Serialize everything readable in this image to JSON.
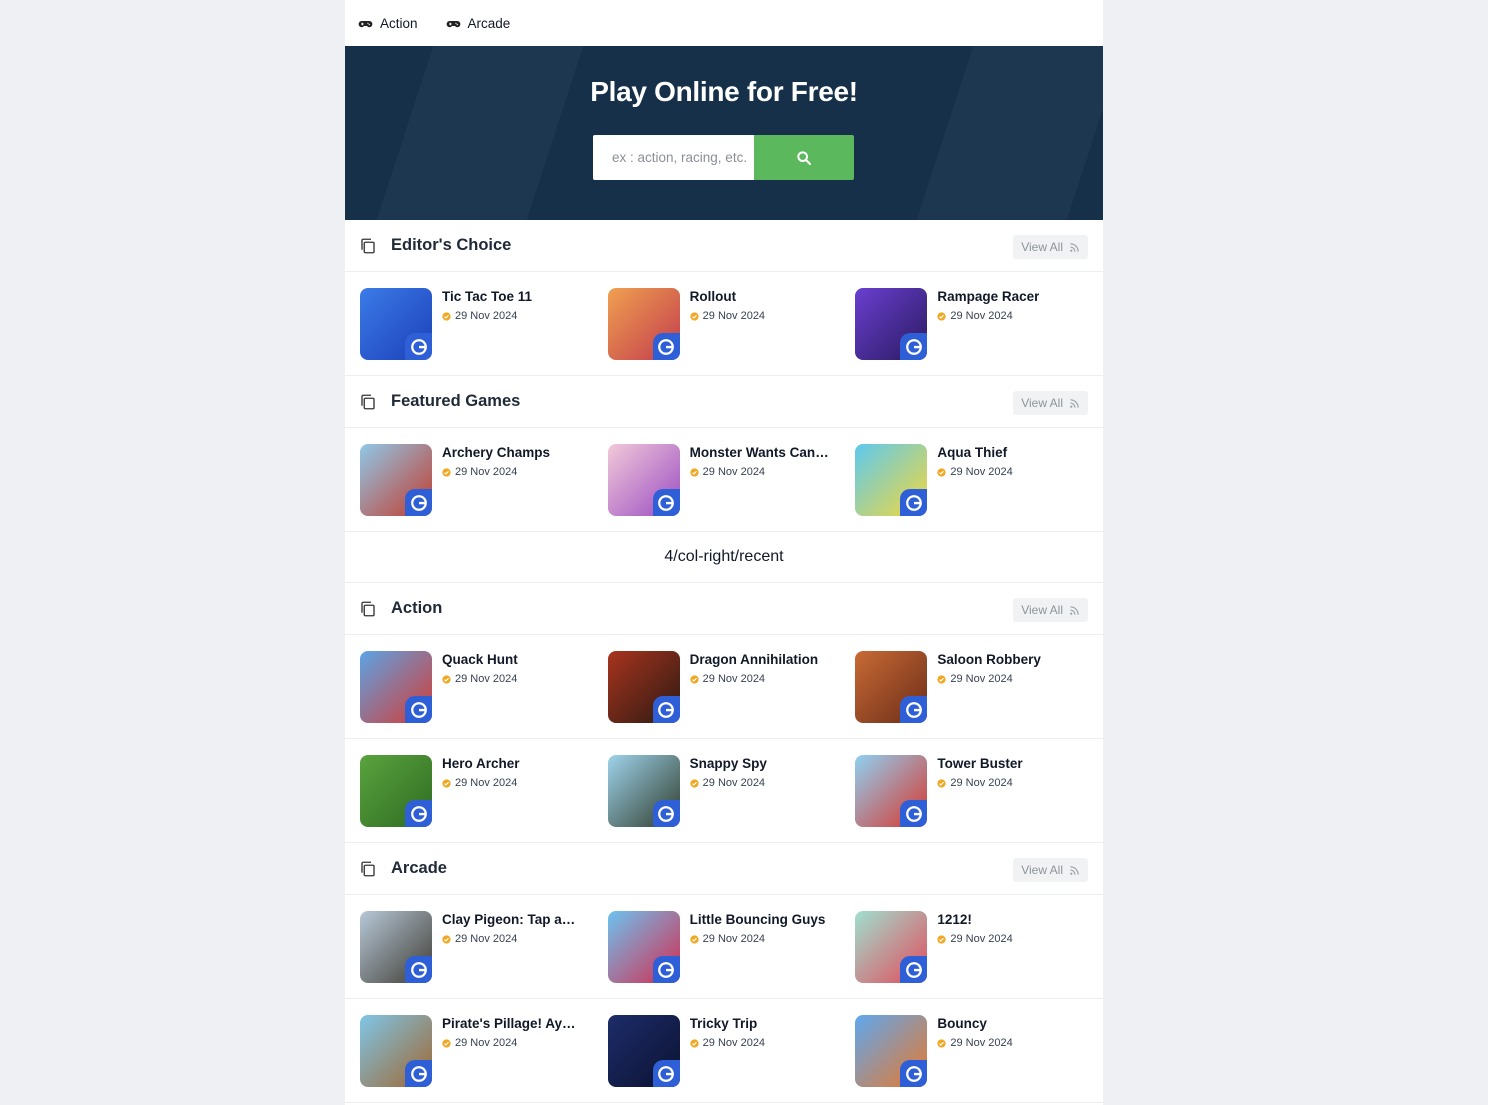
{
  "nav": {
    "items": [
      {
        "label": "Action"
      },
      {
        "label": "Arcade"
      }
    ]
  },
  "hero": {
    "title": "Play Online for Free!",
    "search_placeholder": "ex : action, racing, etc."
  },
  "view_all_label": "View All",
  "ad_slot_text": "4/col-right/recent",
  "sections": [
    {
      "title": "Editor's Choice",
      "rows": [
        [
          {
            "title": "Tic Tac Toe 11",
            "date": "29 Nov 2024",
            "colors": [
              "#3c7be8",
              "#1b3fb8"
            ]
          },
          {
            "title": "Rollout",
            "date": "29 Nov 2024",
            "colors": [
              "#f0a050",
              "#c23b4d"
            ]
          },
          {
            "title": "Rampage Racer",
            "date": "29 Nov 2024",
            "colors": [
              "#6a3fd0",
              "#2a1a60"
            ]
          }
        ]
      ]
    },
    {
      "title": "Featured Games",
      "rows": [
        [
          {
            "title": "Archery Champs",
            "date": "29 Nov 2024",
            "colors": [
              "#8fc8e8",
              "#c33a2b"
            ]
          },
          {
            "title": "Monster Wants Candy",
            "date": "29 Nov 2024",
            "colors": [
              "#f2c9d9",
              "#9a4cc2"
            ]
          },
          {
            "title": "Aqua Thief",
            "date": "29 Nov 2024",
            "colors": [
              "#5cc9ef",
              "#f4d83a"
            ]
          }
        ]
      ]
    },
    {
      "title": "Action",
      "rows": [
        [
          {
            "title": "Quack Hunt",
            "date": "29 Nov 2024",
            "colors": [
              "#5ba4e6",
              "#d63a32"
            ]
          },
          {
            "title": "Dragon Annihilation",
            "date": "29 Nov 2024",
            "colors": [
              "#a8341f",
              "#2b1a12"
            ]
          },
          {
            "title": "Saloon Robbery",
            "date": "29 Nov 2024",
            "colors": [
              "#c86a35",
              "#6b2d18"
            ]
          }
        ],
        [
          {
            "title": "Hero Archer",
            "date": "29 Nov 2024",
            "colors": [
              "#5aa33e",
              "#2e6b22"
            ]
          },
          {
            "title": "Snappy Spy",
            "date": "29 Nov 2024",
            "colors": [
              "#9fd3ec",
              "#2e3b2a"
            ]
          },
          {
            "title": "Tower Buster",
            "date": "29 Nov 2024",
            "colors": [
              "#8fd1f2",
              "#d8352b"
            ]
          }
        ]
      ]
    },
    {
      "title": "Arcade",
      "rows": [
        [
          {
            "title": "Clay Pigeon: Tap and ...",
            "date": "29 Nov 2024",
            "colors": [
              "#b7c8d8",
              "#3e3b32"
            ]
          },
          {
            "title": "Little Bouncing Guys",
            "date": "29 Nov 2024",
            "colors": [
              "#6cc3f0",
              "#d52a4e"
            ]
          },
          {
            "title": "1212!",
            "date": "29 Nov 2024",
            "colors": [
              "#9fe0d0",
              "#e24a5a"
            ]
          }
        ],
        [
          {
            "title": "Pirate's Pillage! Aye! ...",
            "date": "29 Nov 2024",
            "colors": [
              "#7fc6e8",
              "#a0652e"
            ]
          },
          {
            "title": "Tricky Trip",
            "date": "29 Nov 2024",
            "colors": [
              "#1d2c6a",
              "#0b1230"
            ]
          },
          {
            "title": "Bouncy",
            "date": "29 Nov 2024",
            "colors": [
              "#5ea8f0",
              "#e8782a"
            ]
          }
        ]
      ]
    }
  ]
}
